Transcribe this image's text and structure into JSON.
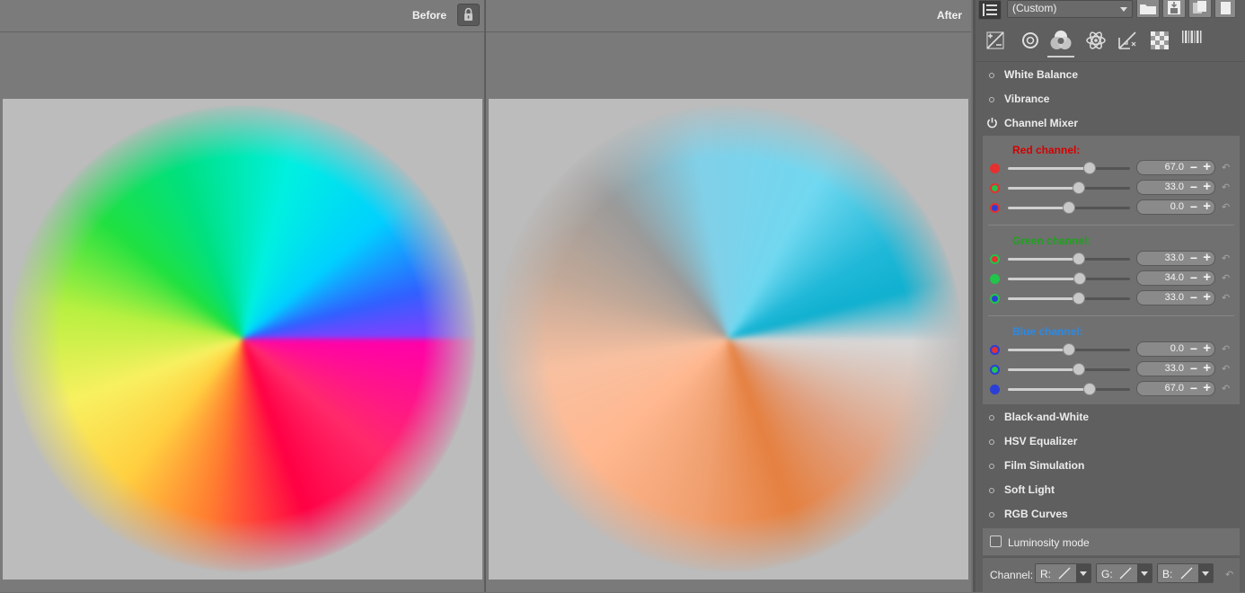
{
  "preview": {
    "before_label": "Before",
    "after_label": "After"
  },
  "toolbar": {
    "profile_value": "(Custom)"
  },
  "tools": [
    {
      "name": "exposure-tab"
    },
    {
      "name": "detail-tab"
    },
    {
      "name": "color-tab",
      "active": true
    },
    {
      "name": "advanced-tab"
    },
    {
      "name": "transform-tab"
    },
    {
      "name": "raw-tab"
    },
    {
      "name": "metadata-tab",
      "label": "META"
    }
  ],
  "sections_top": [
    {
      "label": "White Balance"
    },
    {
      "label": "Vibrance"
    }
  ],
  "channel_mixer": {
    "title": "Channel Mixer",
    "channels": [
      {
        "title": "Red channel:",
        "title_color": "#d40000",
        "rows": [
          {
            "source": "red",
            "value": 67.0,
            "display": "67.0"
          },
          {
            "source": "green",
            "value": 33.0,
            "display": "33.0"
          },
          {
            "source": "blue",
            "value": 0.0,
            "display": "0.0"
          }
        ]
      },
      {
        "title": "Green channel:",
        "title_color": "#1fa11f",
        "rows": [
          {
            "source": "red",
            "value": 33.0,
            "display": "33.0"
          },
          {
            "source": "green",
            "value": 34.0,
            "display": "34.0"
          },
          {
            "source": "blue",
            "value": 33.0,
            "display": "33.0"
          }
        ]
      },
      {
        "title": "Blue channel:",
        "title_color": "#2a8ae6",
        "rows": [
          {
            "source": "red",
            "value": 0.0,
            "display": "0.0"
          },
          {
            "source": "green",
            "value": 33.0,
            "display": "33.0"
          },
          {
            "source": "blue",
            "value": 67.0,
            "display": "67.0"
          }
        ]
      }
    ],
    "slider_range": [
      -200,
      200
    ]
  },
  "sections_bottom": [
    {
      "label": "Black-and-White"
    },
    {
      "label": "HSV Equalizer"
    },
    {
      "label": "Film Simulation"
    },
    {
      "label": "Soft Light"
    },
    {
      "label": "RGB Curves"
    }
  ],
  "rgb_curves": {
    "luminosity_label": "Luminosity mode",
    "luminosity_checked": false,
    "channel_label": "Channel:",
    "buttons": [
      {
        "label": "R:"
      },
      {
        "label": "G:"
      },
      {
        "label": "B:"
      }
    ]
  },
  "colors": {
    "red_dot": "#e53030",
    "green_dot": "#22c44a",
    "blue_dot": "#2a3fd6"
  }
}
